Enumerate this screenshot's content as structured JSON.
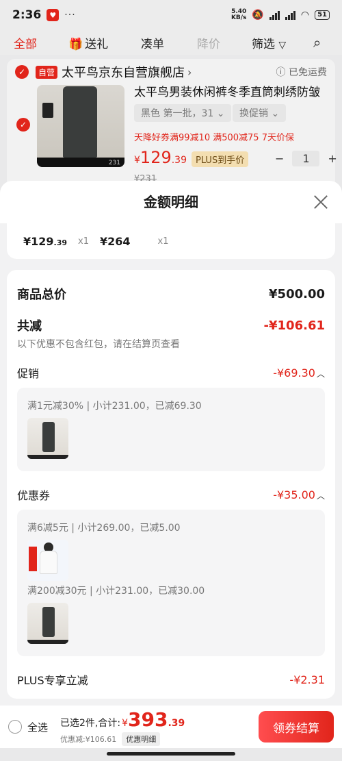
{
  "status": {
    "time": "2:36",
    "net_speed_value": "5.40",
    "net_speed_unit": "KB/s",
    "battery": "51",
    "dots": "···"
  },
  "tabs": [
    {
      "label": "全部"
    },
    {
      "label": "送礼"
    },
    {
      "label": "凑单"
    },
    {
      "label": "降价"
    },
    {
      "label": "筛选"
    }
  ],
  "shop": {
    "tag": "自营",
    "name": "太平鸟京东自营旗舰店",
    "arrow": "›",
    "shipping": "ⓘ 已免运费"
  },
  "product": {
    "title": "太平鸟男装休闲裤冬季直筒刺绣防皱",
    "spec": "黑色 第一批，31 ⌄",
    "promo_chip": "换促销 ⌄",
    "promo_text": "天降好券满99减10   满500减75   7天价保",
    "price_currency": "¥",
    "price_int": "129",
    "price_dec": ".39",
    "plus_tag": "PLUS到手价",
    "qty": "1",
    "minus": "−",
    "plus": "+",
    "orig_price": "¥231",
    "img_number": "231"
  },
  "sheet": {
    "title": "金额明细",
    "items": [
      {
        "price_int": "¥129",
        "price_dec": ".39",
        "qty": "x1"
      },
      {
        "price_int": "¥264",
        "price_dec": "",
        "qty": "x1"
      }
    ],
    "total_label": "商品总价",
    "total_value": "¥500.00",
    "discount_label": "共减",
    "discount_value": "-¥106.61",
    "discount_hint": "以下优惠不包含红包，请在结算页查看",
    "promo": {
      "label": "促销",
      "value": "-¥69.30",
      "line": "满1元减30% | 小计231.00，已减69.30"
    },
    "coupon": {
      "label": "优惠券",
      "value": "-¥35.00",
      "line1": "满6减5元 | 小计269.00，已减5.00",
      "line2": "满200减30元 | 小计231.00，已减30.00"
    },
    "plus": {
      "label": "PLUS专享立减",
      "value": "-¥2.31"
    }
  },
  "bottom": {
    "select_all": "全选",
    "selected_text": "已选2件,合计:",
    "total_cur": "¥",
    "total_int": "393",
    "total_dec": ".39",
    "discount_text": "优惠减:¥106.61",
    "detail_btn": "优惠明细",
    "checkout": "领券结算"
  },
  "colors": {
    "accent": "#e1251b",
    "plus_gold": "#f3deb1"
  }
}
